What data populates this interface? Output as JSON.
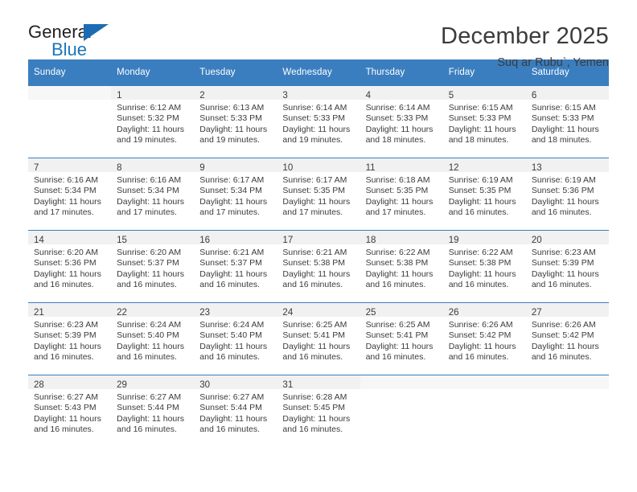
{
  "logo": {
    "word_one": "General",
    "word_two": "Blue",
    "triangle_color": "#1b6cb3",
    "blue_text_color": "#1b75bb"
  },
  "header": {
    "title": "December 2025",
    "subtitle": "Suq ar Rubu`, Yemen"
  },
  "theme": {
    "header_blue": "#3a7ebf",
    "daynum_band": "#f1f1f1",
    "text": "#3b3b3b"
  },
  "calendar": {
    "weekday_headers": [
      "Sunday",
      "Monday",
      "Tuesday",
      "Wednesday",
      "Thursday",
      "Friday",
      "Saturday"
    ],
    "labels": {
      "sunrise": "Sunrise:",
      "sunset": "Sunset:",
      "daylight": "Daylight:"
    },
    "weeks": [
      [
        {
          "day": "",
          "sunrise": "",
          "sunset": "",
          "daylight_line1": "",
          "daylight_line2": ""
        },
        {
          "day": "1",
          "sunrise": "Sunrise: 6:12 AM",
          "sunset": "Sunset: 5:32 PM",
          "daylight_line1": "Daylight: 11 hours",
          "daylight_line2": "and 19 minutes."
        },
        {
          "day": "2",
          "sunrise": "Sunrise: 6:13 AM",
          "sunset": "Sunset: 5:33 PM",
          "daylight_line1": "Daylight: 11 hours",
          "daylight_line2": "and 19 minutes."
        },
        {
          "day": "3",
          "sunrise": "Sunrise: 6:14 AM",
          "sunset": "Sunset: 5:33 PM",
          "daylight_line1": "Daylight: 11 hours",
          "daylight_line2": "and 19 minutes."
        },
        {
          "day": "4",
          "sunrise": "Sunrise: 6:14 AM",
          "sunset": "Sunset: 5:33 PM",
          "daylight_line1": "Daylight: 11 hours",
          "daylight_line2": "and 18 minutes."
        },
        {
          "day": "5",
          "sunrise": "Sunrise: 6:15 AM",
          "sunset": "Sunset: 5:33 PM",
          "daylight_line1": "Daylight: 11 hours",
          "daylight_line2": "and 18 minutes."
        },
        {
          "day": "6",
          "sunrise": "Sunrise: 6:15 AM",
          "sunset": "Sunset: 5:33 PM",
          "daylight_line1": "Daylight: 11 hours",
          "daylight_line2": "and 18 minutes."
        }
      ],
      [
        {
          "day": "7",
          "sunrise": "Sunrise: 6:16 AM",
          "sunset": "Sunset: 5:34 PM",
          "daylight_line1": "Daylight: 11 hours",
          "daylight_line2": "and 17 minutes."
        },
        {
          "day": "8",
          "sunrise": "Sunrise: 6:16 AM",
          "sunset": "Sunset: 5:34 PM",
          "daylight_line1": "Daylight: 11 hours",
          "daylight_line2": "and 17 minutes."
        },
        {
          "day": "9",
          "sunrise": "Sunrise: 6:17 AM",
          "sunset": "Sunset: 5:34 PM",
          "daylight_line1": "Daylight: 11 hours",
          "daylight_line2": "and 17 minutes."
        },
        {
          "day": "10",
          "sunrise": "Sunrise: 6:17 AM",
          "sunset": "Sunset: 5:35 PM",
          "daylight_line1": "Daylight: 11 hours",
          "daylight_line2": "and 17 minutes."
        },
        {
          "day": "11",
          "sunrise": "Sunrise: 6:18 AM",
          "sunset": "Sunset: 5:35 PM",
          "daylight_line1": "Daylight: 11 hours",
          "daylight_line2": "and 17 minutes."
        },
        {
          "day": "12",
          "sunrise": "Sunrise: 6:19 AM",
          "sunset": "Sunset: 5:35 PM",
          "daylight_line1": "Daylight: 11 hours",
          "daylight_line2": "and 16 minutes."
        },
        {
          "day": "13",
          "sunrise": "Sunrise: 6:19 AM",
          "sunset": "Sunset: 5:36 PM",
          "daylight_line1": "Daylight: 11 hours",
          "daylight_line2": "and 16 minutes."
        }
      ],
      [
        {
          "day": "14",
          "sunrise": "Sunrise: 6:20 AM",
          "sunset": "Sunset: 5:36 PM",
          "daylight_line1": "Daylight: 11 hours",
          "daylight_line2": "and 16 minutes."
        },
        {
          "day": "15",
          "sunrise": "Sunrise: 6:20 AM",
          "sunset": "Sunset: 5:37 PM",
          "daylight_line1": "Daylight: 11 hours",
          "daylight_line2": "and 16 minutes."
        },
        {
          "day": "16",
          "sunrise": "Sunrise: 6:21 AM",
          "sunset": "Sunset: 5:37 PM",
          "daylight_line1": "Daylight: 11 hours",
          "daylight_line2": "and 16 minutes."
        },
        {
          "day": "17",
          "sunrise": "Sunrise: 6:21 AM",
          "sunset": "Sunset: 5:38 PM",
          "daylight_line1": "Daylight: 11 hours",
          "daylight_line2": "and 16 minutes."
        },
        {
          "day": "18",
          "sunrise": "Sunrise: 6:22 AM",
          "sunset": "Sunset: 5:38 PM",
          "daylight_line1": "Daylight: 11 hours",
          "daylight_line2": "and 16 minutes."
        },
        {
          "day": "19",
          "sunrise": "Sunrise: 6:22 AM",
          "sunset": "Sunset: 5:38 PM",
          "daylight_line1": "Daylight: 11 hours",
          "daylight_line2": "and 16 minutes."
        },
        {
          "day": "20",
          "sunrise": "Sunrise: 6:23 AM",
          "sunset": "Sunset: 5:39 PM",
          "daylight_line1": "Daylight: 11 hours",
          "daylight_line2": "and 16 minutes."
        }
      ],
      [
        {
          "day": "21",
          "sunrise": "Sunrise: 6:23 AM",
          "sunset": "Sunset: 5:39 PM",
          "daylight_line1": "Daylight: 11 hours",
          "daylight_line2": "and 16 minutes."
        },
        {
          "day": "22",
          "sunrise": "Sunrise: 6:24 AM",
          "sunset": "Sunset: 5:40 PM",
          "daylight_line1": "Daylight: 11 hours",
          "daylight_line2": "and 16 minutes."
        },
        {
          "day": "23",
          "sunrise": "Sunrise: 6:24 AM",
          "sunset": "Sunset: 5:40 PM",
          "daylight_line1": "Daylight: 11 hours",
          "daylight_line2": "and 16 minutes."
        },
        {
          "day": "24",
          "sunrise": "Sunrise: 6:25 AM",
          "sunset": "Sunset: 5:41 PM",
          "daylight_line1": "Daylight: 11 hours",
          "daylight_line2": "and 16 minutes."
        },
        {
          "day": "25",
          "sunrise": "Sunrise: 6:25 AM",
          "sunset": "Sunset: 5:41 PM",
          "daylight_line1": "Daylight: 11 hours",
          "daylight_line2": "and 16 minutes."
        },
        {
          "day": "26",
          "sunrise": "Sunrise: 6:26 AM",
          "sunset": "Sunset: 5:42 PM",
          "daylight_line1": "Daylight: 11 hours",
          "daylight_line2": "and 16 minutes."
        },
        {
          "day": "27",
          "sunrise": "Sunrise: 6:26 AM",
          "sunset": "Sunset: 5:42 PM",
          "daylight_line1": "Daylight: 11 hours",
          "daylight_line2": "and 16 minutes."
        }
      ],
      [
        {
          "day": "28",
          "sunrise": "Sunrise: 6:27 AM",
          "sunset": "Sunset: 5:43 PM",
          "daylight_line1": "Daylight: 11 hours",
          "daylight_line2": "and 16 minutes."
        },
        {
          "day": "29",
          "sunrise": "Sunrise: 6:27 AM",
          "sunset": "Sunset: 5:44 PM",
          "daylight_line1": "Daylight: 11 hours",
          "daylight_line2": "and 16 minutes."
        },
        {
          "day": "30",
          "sunrise": "Sunrise: 6:27 AM",
          "sunset": "Sunset: 5:44 PM",
          "daylight_line1": "Daylight: 11 hours",
          "daylight_line2": "and 16 minutes."
        },
        {
          "day": "31",
          "sunrise": "Sunrise: 6:28 AM",
          "sunset": "Sunset: 5:45 PM",
          "daylight_line1": "Daylight: 11 hours",
          "daylight_line2": "and 16 minutes."
        },
        {
          "day": "",
          "sunrise": "",
          "sunset": "",
          "daylight_line1": "",
          "daylight_line2": ""
        },
        {
          "day": "",
          "sunrise": "",
          "sunset": "",
          "daylight_line1": "",
          "daylight_line2": ""
        },
        {
          "day": "",
          "sunrise": "",
          "sunset": "",
          "daylight_line1": "",
          "daylight_line2": ""
        }
      ]
    ]
  }
}
